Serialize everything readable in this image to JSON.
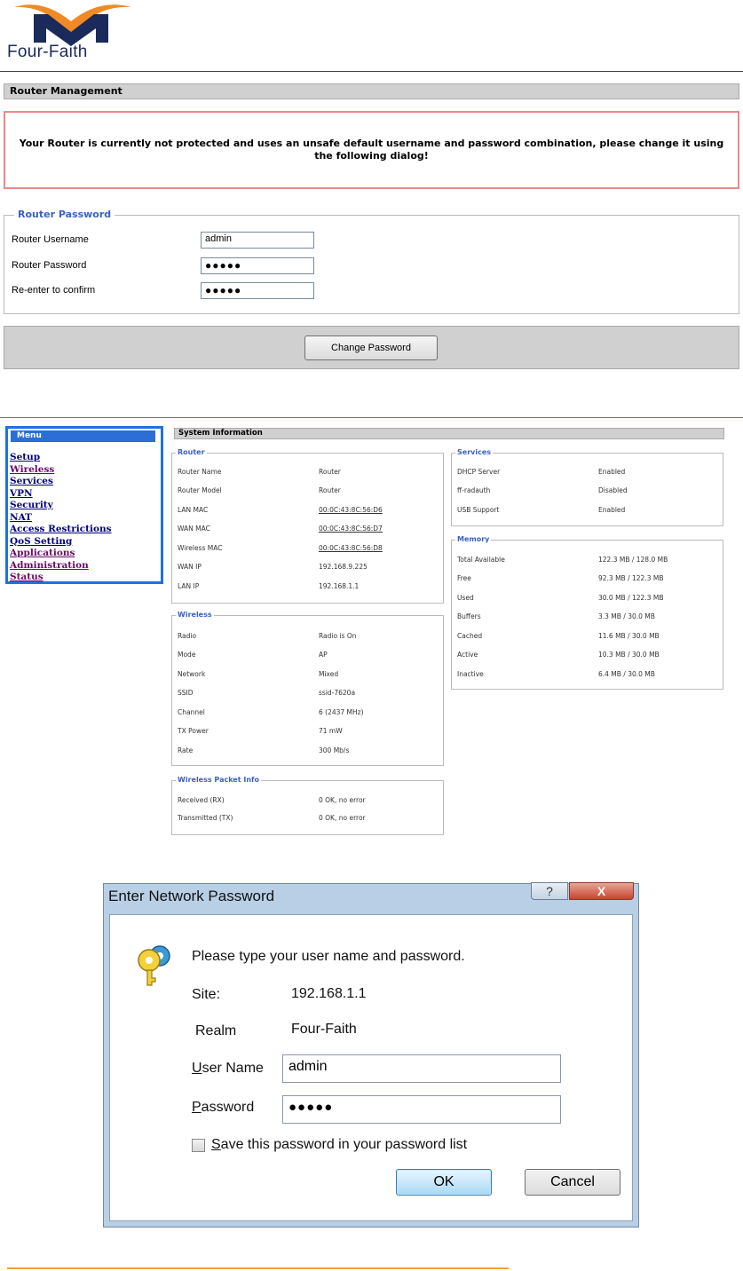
{
  "header": {
    "logo_text": "Four-Faith"
  },
  "router_management": {
    "title": "Router Management",
    "warning": "Your Router is currently not protected and uses an unsafe default username and password combination, please change it using the following dialog!",
    "legend": "Router Password",
    "fields": [
      {
        "label": "Router Username",
        "value": "admin"
      },
      {
        "label": "Router Password",
        "value": "●●●●●"
      },
      {
        "label": "Re-enter to confirm",
        "value": "●●●●●"
      }
    ],
    "button": "Change Password"
  },
  "menu": {
    "title": "Menu",
    "items": [
      "Setup",
      "Wireless",
      "Services",
      "VPN",
      "Security",
      "NAT",
      "Access Restrictions",
      "QoS Setting",
      "Applications",
      "Administration",
      "Status"
    ]
  },
  "system_info": {
    "title": "System Information",
    "router": {
      "legend": "Router",
      "rows": [
        {
          "k": "Router Name",
          "v": "Router"
        },
        {
          "k": "Router Model",
          "v": "Router"
        },
        {
          "k": "LAN MAC",
          "v": "00:0C:43:8C:56:D6"
        },
        {
          "k": "WAN MAC",
          "v": "00:0C:43:8C:56:D7"
        },
        {
          "k": "Wireless MAC",
          "v": "00:0C:43:8C:56:D8"
        },
        {
          "k": "WAN IP",
          "v": "192.168.9.225"
        },
        {
          "k": "LAN IP",
          "v": "192.168.1.1"
        }
      ]
    },
    "wireless": {
      "legend": "Wireless",
      "rows": [
        {
          "k": "Radio",
          "v": "Radio is On"
        },
        {
          "k": "Mode",
          "v": "AP"
        },
        {
          "k": "Network",
          "v": "Mixed"
        },
        {
          "k": "SSID",
          "v": "ssid-7620a"
        },
        {
          "k": "Channel",
          "v": "6 (2437 MHz)"
        },
        {
          "k": "TX Power",
          "v": "71 mW"
        },
        {
          "k": "Rate",
          "v": "300 Mb/s"
        }
      ]
    },
    "packet": {
      "legend": "Wireless Packet Info",
      "rows": [
        {
          "k": "Received (RX)",
          "v": "0 OK, no error"
        },
        {
          "k": "Transmitted (TX)",
          "v": "0 OK, no error"
        }
      ]
    },
    "services": {
      "legend": "Services",
      "rows": [
        {
          "k": "DHCP Server",
          "v": "Enabled"
        },
        {
          "k": "ff-radauth",
          "v": "Disabled"
        },
        {
          "k": "USB Support",
          "v": "Enabled"
        }
      ]
    },
    "memory": {
      "legend": "Memory",
      "rows": [
        {
          "k": "Total Available",
          "v": "122.3 MB / 128.0 MB"
        },
        {
          "k": "Free",
          "v": "92.3 MB / 122.3 MB"
        },
        {
          "k": "Used",
          "v": "30.0 MB / 122.3 MB"
        },
        {
          "k": "Buffers",
          "v": "3.3 MB / 30.0 MB"
        },
        {
          "k": "Cached",
          "v": "11.6 MB / 30.0 MB"
        },
        {
          "k": "Active",
          "v": "10.3 MB / 30.0 MB"
        },
        {
          "k": "Inactive",
          "v": "6.4 MB / 30.0 MB"
        }
      ]
    }
  },
  "dialog": {
    "title": "Enter Network Password",
    "help": "?",
    "close": "X",
    "prompt": "Please type your user name and password.",
    "site_label": "Site:",
    "site_value": "192.168.1.1",
    "realm_label": "Realm",
    "realm_value": "Four-Faith",
    "username_label_u": "U",
    "username_label_rest": "ser Name",
    "username_value": "admin",
    "password_label_u": "P",
    "password_label_rest": "assword",
    "password_value": "●●●●●",
    "save_label_u": "S",
    "save_label_rest": "ave this password in your password list",
    "ok": "OK",
    "cancel": "Cancel"
  }
}
